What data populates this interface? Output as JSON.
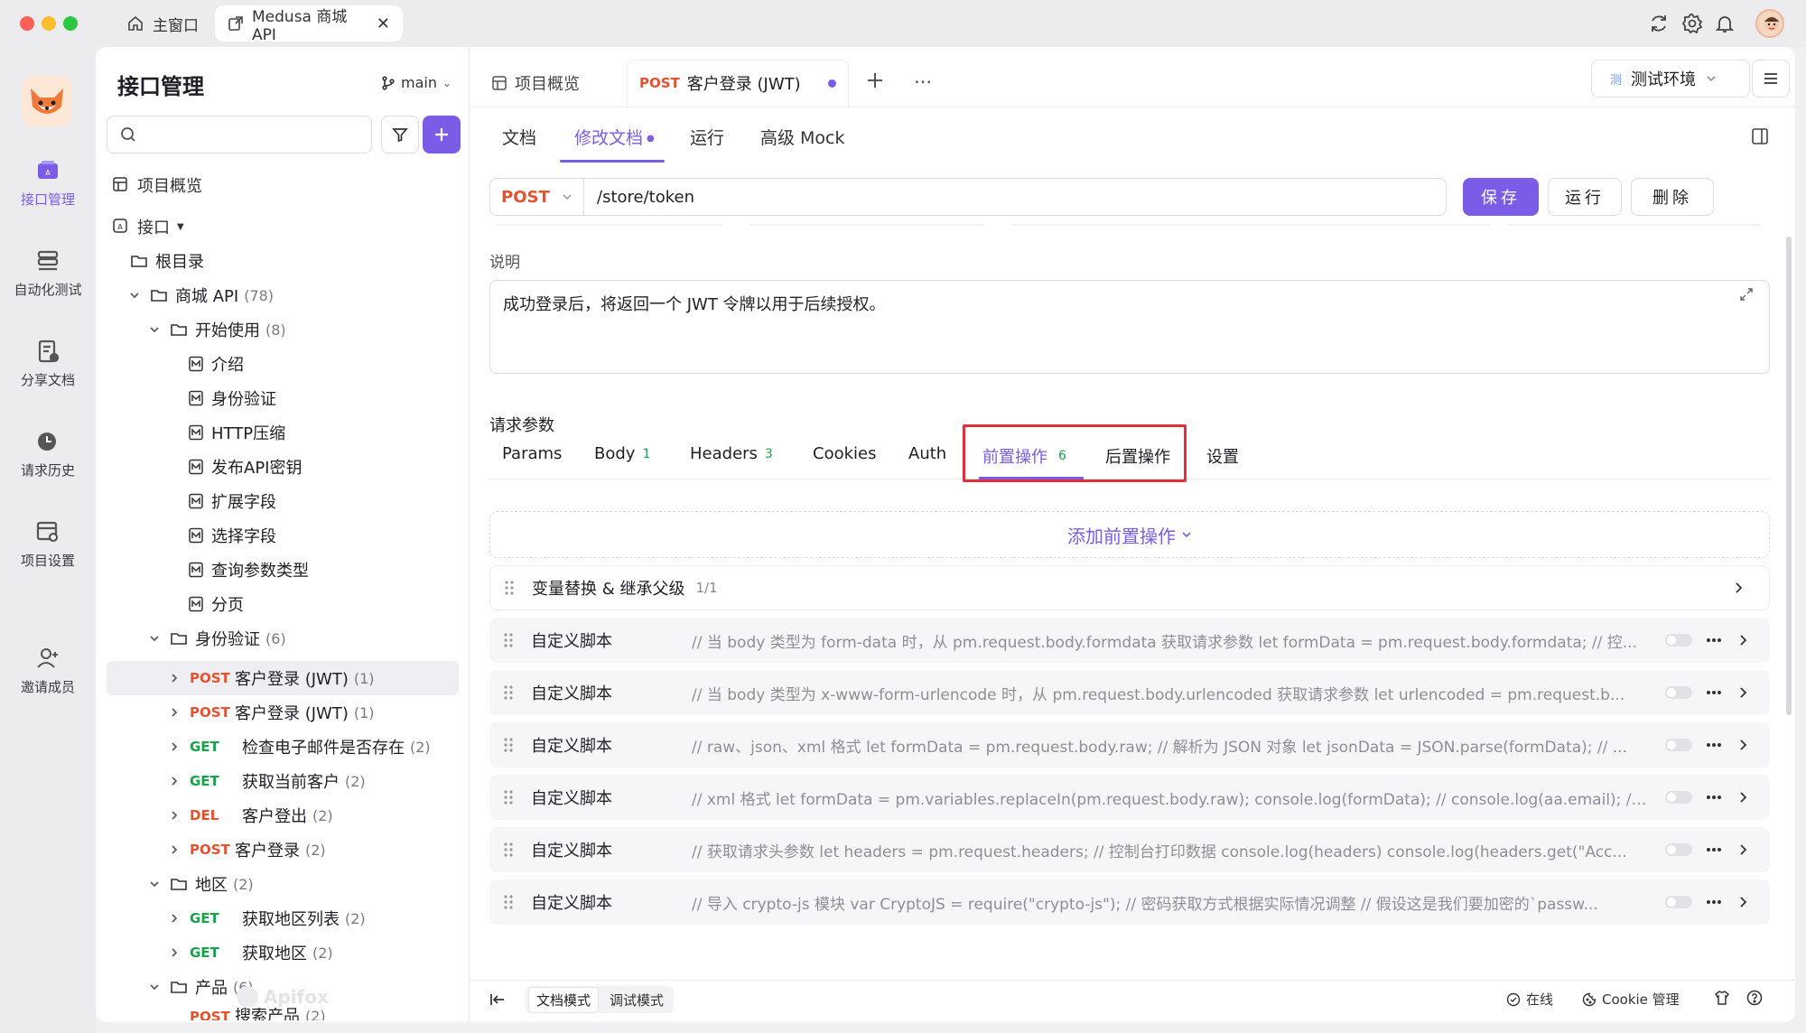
{
  "window": {
    "tabs": [
      {
        "label": "主窗口"
      },
      {
        "label": "Medusa 商城 API"
      }
    ]
  },
  "rail": {
    "items": [
      {
        "label": "接口管理"
      },
      {
        "label": "自动化测试"
      },
      {
        "label": "分享文档"
      },
      {
        "label": "请求历史"
      },
      {
        "label": "项目设置"
      },
      {
        "label": "邀请成员"
      }
    ]
  },
  "tree": {
    "title": "接口管理",
    "branch": "main",
    "overview": "项目概览",
    "api_label": "接口",
    "root": "根目录",
    "shop": {
      "label": "商城 API",
      "count": "(78)"
    },
    "getting_started": {
      "label": "开始使用",
      "count": "(8)"
    },
    "docs": [
      "介绍",
      "身份验证",
      "HTTP压缩",
      "发布API密钥",
      "扩展字段",
      "选择字段",
      "查询参数类型",
      "分页"
    ],
    "auth_folder": {
      "label": "身份验证",
      "count": "(6)"
    },
    "auth_items": [
      {
        "method": "POST",
        "label": "客户登录 (JWT)",
        "count": "(1)"
      },
      {
        "method": "POST",
        "label": "客户登录 (JWT)",
        "count": "(1)"
      },
      {
        "method": "GET",
        "label": "检查电子邮件是否存在",
        "count": "(2)"
      },
      {
        "method": "GET",
        "label": "获取当前客户",
        "count": "(2)"
      },
      {
        "method": "DEL",
        "label": "客户登出",
        "count": "(2)"
      },
      {
        "method": "POST",
        "label": "客户登录",
        "count": "(2)"
      }
    ],
    "region_folder": {
      "label": "地区",
      "count": "(2)"
    },
    "region_items": [
      {
        "method": "GET",
        "label": "获取地区列表",
        "count": "(2)"
      },
      {
        "method": "GET",
        "label": "获取地区",
        "count": "(2)"
      }
    ],
    "product_folder": {
      "label": "产品",
      "count": "(6)"
    },
    "product_partial": {
      "method": "POST",
      "label": "搜索产品",
      "count": "(2)"
    },
    "watermark": "Apifox"
  },
  "main": {
    "tabs": {
      "overview": "项目概览",
      "active_method": "POST",
      "active_label": "客户登录 (JWT)"
    },
    "env": "测试环境",
    "env_tag": "测",
    "subtabs": [
      "文档",
      "修改文档",
      "运行",
      "高级 Mock"
    ],
    "request": {
      "method": "POST",
      "url": "/store/token",
      "save": "保存",
      "run": "运行",
      "delete": "删除"
    },
    "description_label": "说明",
    "description": "成功登录后，将返回一个 JWT 令牌以用于后续授权。",
    "params_label": "请求参数",
    "param_tabs": [
      {
        "label": "Params"
      },
      {
        "label": "Body",
        "badge": "1"
      },
      {
        "label": "Headers",
        "badge": "3"
      },
      {
        "label": "Cookies"
      },
      {
        "label": "Auth"
      },
      {
        "label": "前置操作",
        "badge": "6"
      },
      {
        "label": "后置操作"
      },
      {
        "label": "设置"
      }
    ],
    "add_pre": "添加前置操作",
    "var_row": {
      "label": "变量替换 & 继承父级",
      "count": "1/1"
    },
    "scripts": [
      {
        "name": "自定义脚本",
        "code": "// 当 body 类型为 form-data 时，从 pm.request.body.formdata 获取请求参数 let formData = pm.request.body.formdata; // 控..."
      },
      {
        "name": "自定义脚本",
        "code": "// 当 body 类型为 x-www-form-urlencode 时，从 pm.request.body.urlencoded 获取请求参数 let urlencoded = pm.request.b..."
      },
      {
        "name": "自定义脚本",
        "code": "// raw、json、xml 格式 let formData = pm.request.body.raw; // 解析为 JSON 对象 let jsonData = JSON.parse(formData); // ..."
      },
      {
        "name": "自定义脚本",
        "code": "// xml 格式 let formData = pm.variables.replaceIn(pm.request.body.raw); console.log(formData); // console.log(aa.email); // ..."
      },
      {
        "name": "自定义脚本",
        "code": "// 获取请求头参数 let headers = pm.request.headers; // 控制台打印数据 console.log(headers) console.log(headers.get(\"Acc..."
      },
      {
        "name": "自定义脚本",
        "code": "// 导入 crypto-js 模块 var CryptoJS = require(\"crypto-js\"); // 密码获取方式根据实际情况调整 // 假设这是我们要加密的`passw..."
      }
    ],
    "footer": {
      "doc_mode": "文档模式",
      "debug_mode": "调试模式",
      "online": "在线",
      "cookie": "Cookie 管理"
    }
  },
  "colors": {
    "accent": "#7b5ce6",
    "post": "#e5532e",
    "get": "#16a34a",
    "highlight_box": "#e0303a"
  }
}
